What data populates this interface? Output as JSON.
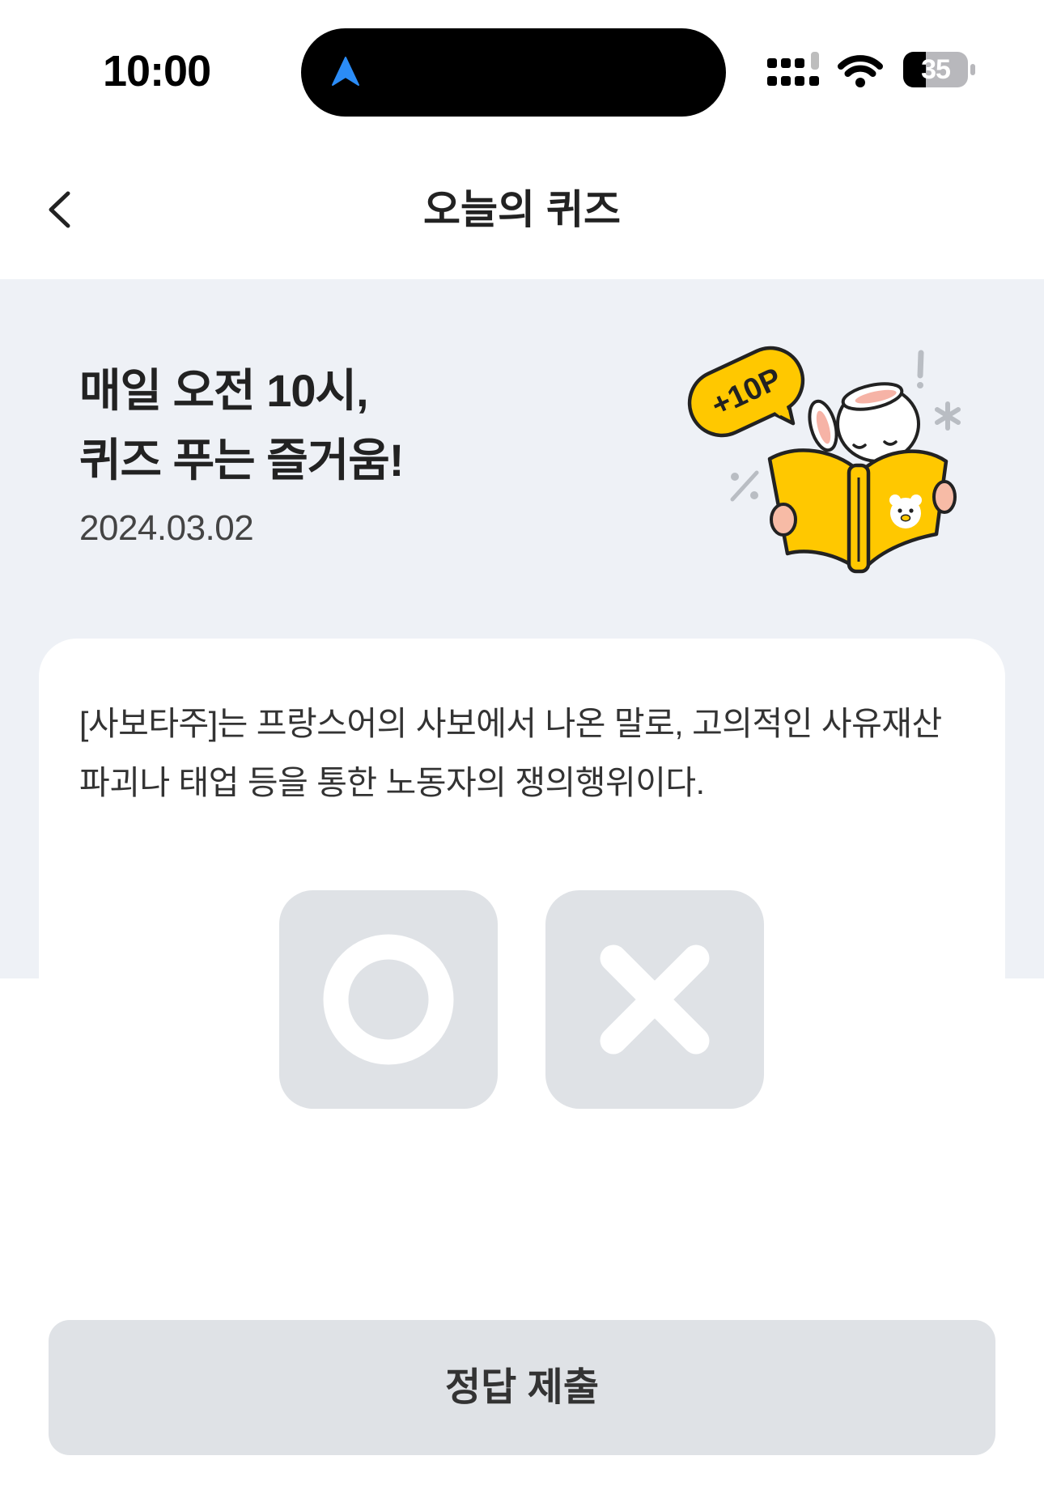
{
  "status_bar": {
    "time": "10:00",
    "battery_level": "35",
    "location_icon": "location-arrow-icon",
    "signal_icon": "cellular-signal-icon",
    "wifi_icon": "wifi-icon",
    "battery_icon": "battery-icon"
  },
  "header": {
    "back_icon": "chevron-left-icon",
    "title": "오늘의 퀴즈"
  },
  "hero": {
    "heading_line1": "매일 오전 10시,",
    "heading_line2": "퀴즈 푸는 즐거움!",
    "date": "2024.03.02",
    "badge_points": "+10P"
  },
  "quiz": {
    "question": "[사보타주]는 프랑스어의 사보에서 나온 말로, 고의적인 사유재산 파괴나 태업 등을 통한 노동자의 쟁의행위이다.",
    "options": [
      {
        "icon": "circle-o-icon"
      },
      {
        "icon": "cross-x-icon"
      }
    ]
  },
  "submit": {
    "label": "정답 제출"
  },
  "colors": {
    "page_background": "#ffffff",
    "hero_background": "#eef1f6",
    "option_button": "#dfe2e6",
    "submit_button": "#dfe2e6",
    "accent_yellow": "#ffc800",
    "text_primary": "#222222",
    "location_blue": "#2b8cf6"
  }
}
